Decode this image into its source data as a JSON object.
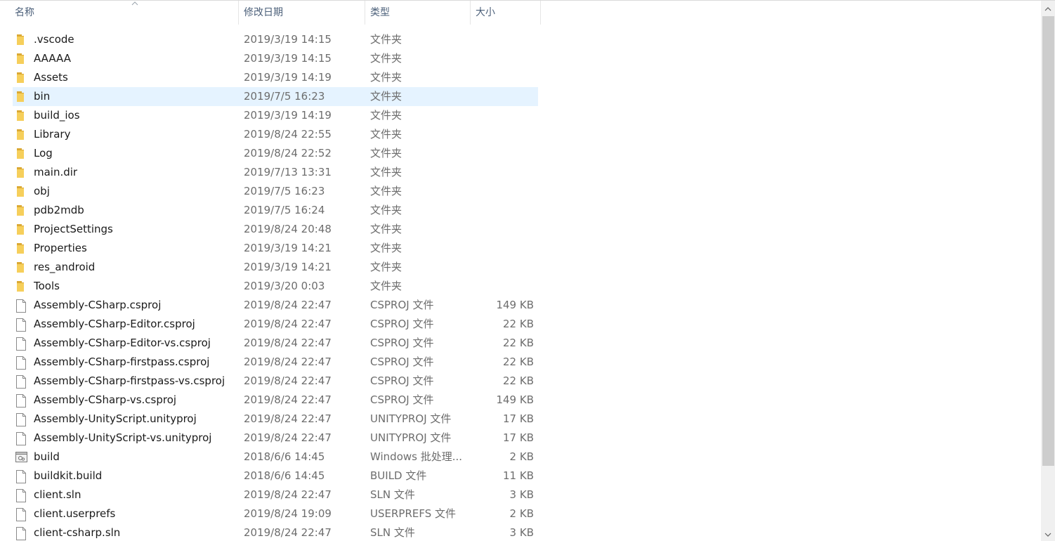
{
  "columns": {
    "name": "名称",
    "date": "修改日期",
    "type": "类型",
    "size": "大小"
  },
  "files": [
    {
      "name": ".vscode",
      "date": "2019/3/19 14:15",
      "type": "文件夹",
      "size": "",
      "icon": "folder-icon"
    },
    {
      "name": "AAAAA",
      "date": "2019/3/19 14:15",
      "type": "文件夹",
      "size": "",
      "icon": "folder-icon"
    },
    {
      "name": "Assets",
      "date": "2019/3/19 14:19",
      "type": "文件夹",
      "size": "",
      "icon": "folder-icon"
    },
    {
      "name": "bin",
      "date": "2019/7/5 16:23",
      "type": "文件夹",
      "size": "",
      "icon": "folder-icon",
      "selected": true
    },
    {
      "name": "build_ios",
      "date": "2019/3/19 14:19",
      "type": "文件夹",
      "size": "",
      "icon": "folder-icon"
    },
    {
      "name": "Library",
      "date": "2019/8/24 22:55",
      "type": "文件夹",
      "size": "",
      "icon": "folder-icon"
    },
    {
      "name": "Log",
      "date": "2019/8/24 22:52",
      "type": "文件夹",
      "size": "",
      "icon": "folder-icon"
    },
    {
      "name": "main.dir",
      "date": "2019/7/13 13:31",
      "type": "文件夹",
      "size": "",
      "icon": "folder-icon"
    },
    {
      "name": "obj",
      "date": "2019/7/5 16:23",
      "type": "文件夹",
      "size": "",
      "icon": "folder-icon"
    },
    {
      "name": "pdb2mdb",
      "date": "2019/7/5 16:24",
      "type": "文件夹",
      "size": "",
      "icon": "folder-icon"
    },
    {
      "name": "ProjectSettings",
      "date": "2019/8/24 20:48",
      "type": "文件夹",
      "size": "",
      "icon": "folder-icon"
    },
    {
      "name": "Properties",
      "date": "2019/3/19 14:21",
      "type": "文件夹",
      "size": "",
      "icon": "folder-icon"
    },
    {
      "name": "res_android",
      "date": "2019/3/19 14:21",
      "type": "文件夹",
      "size": "",
      "icon": "folder-icon"
    },
    {
      "name": "Tools",
      "date": "2019/3/20 0:03",
      "type": "文件夹",
      "size": "",
      "icon": "folder-icon"
    },
    {
      "name": "Assembly-CSharp.csproj",
      "date": "2019/8/24 22:47",
      "type": "CSPROJ 文件",
      "size": "149 KB",
      "icon": "file-icon"
    },
    {
      "name": "Assembly-CSharp-Editor.csproj",
      "date": "2019/8/24 22:47",
      "type": "CSPROJ 文件",
      "size": "22 KB",
      "icon": "file-icon"
    },
    {
      "name": "Assembly-CSharp-Editor-vs.csproj",
      "date": "2019/8/24 22:47",
      "type": "CSPROJ 文件",
      "size": "22 KB",
      "icon": "file-icon"
    },
    {
      "name": "Assembly-CSharp-firstpass.csproj",
      "date": "2019/8/24 22:47",
      "type": "CSPROJ 文件",
      "size": "22 KB",
      "icon": "file-icon"
    },
    {
      "name": "Assembly-CSharp-firstpass-vs.csproj",
      "date": "2019/8/24 22:47",
      "type": "CSPROJ 文件",
      "size": "22 KB",
      "icon": "file-icon"
    },
    {
      "name": "Assembly-CSharp-vs.csproj",
      "date": "2019/8/24 22:47",
      "type": "CSPROJ 文件",
      "size": "149 KB",
      "icon": "file-icon"
    },
    {
      "name": "Assembly-UnityScript.unityproj",
      "date": "2019/8/24 22:47",
      "type": "UNITYPROJ 文件",
      "size": "17 KB",
      "icon": "file-icon"
    },
    {
      "name": "Assembly-UnityScript-vs.unityproj",
      "date": "2019/8/24 22:47",
      "type": "UNITYPROJ 文件",
      "size": "17 KB",
      "icon": "file-icon"
    },
    {
      "name": "build",
      "date": "2018/6/6 14:45",
      "type": "Windows 批处理...",
      "size": "2 KB",
      "icon": "batch-file-icon"
    },
    {
      "name": "buildkit.build",
      "date": "2018/6/6 14:45",
      "type": "BUILD 文件",
      "size": "11 KB",
      "icon": "file-icon"
    },
    {
      "name": "client.sln",
      "date": "2019/8/24 22:47",
      "type": "SLN 文件",
      "size": "3 KB",
      "icon": "file-icon"
    },
    {
      "name": "client.userprefs",
      "date": "2019/8/24 19:09",
      "type": "USERPREFS 文件",
      "size": "2 KB",
      "icon": "file-icon"
    },
    {
      "name": "client-csharp.sln",
      "date": "2019/8/24 22:47",
      "type": "SLN 文件",
      "size": "3 KB",
      "icon": "file-icon"
    }
  ],
  "colors": {
    "selection": "#e5f3ff",
    "folder": "#f3c44b",
    "header_text": "#4c607a"
  }
}
